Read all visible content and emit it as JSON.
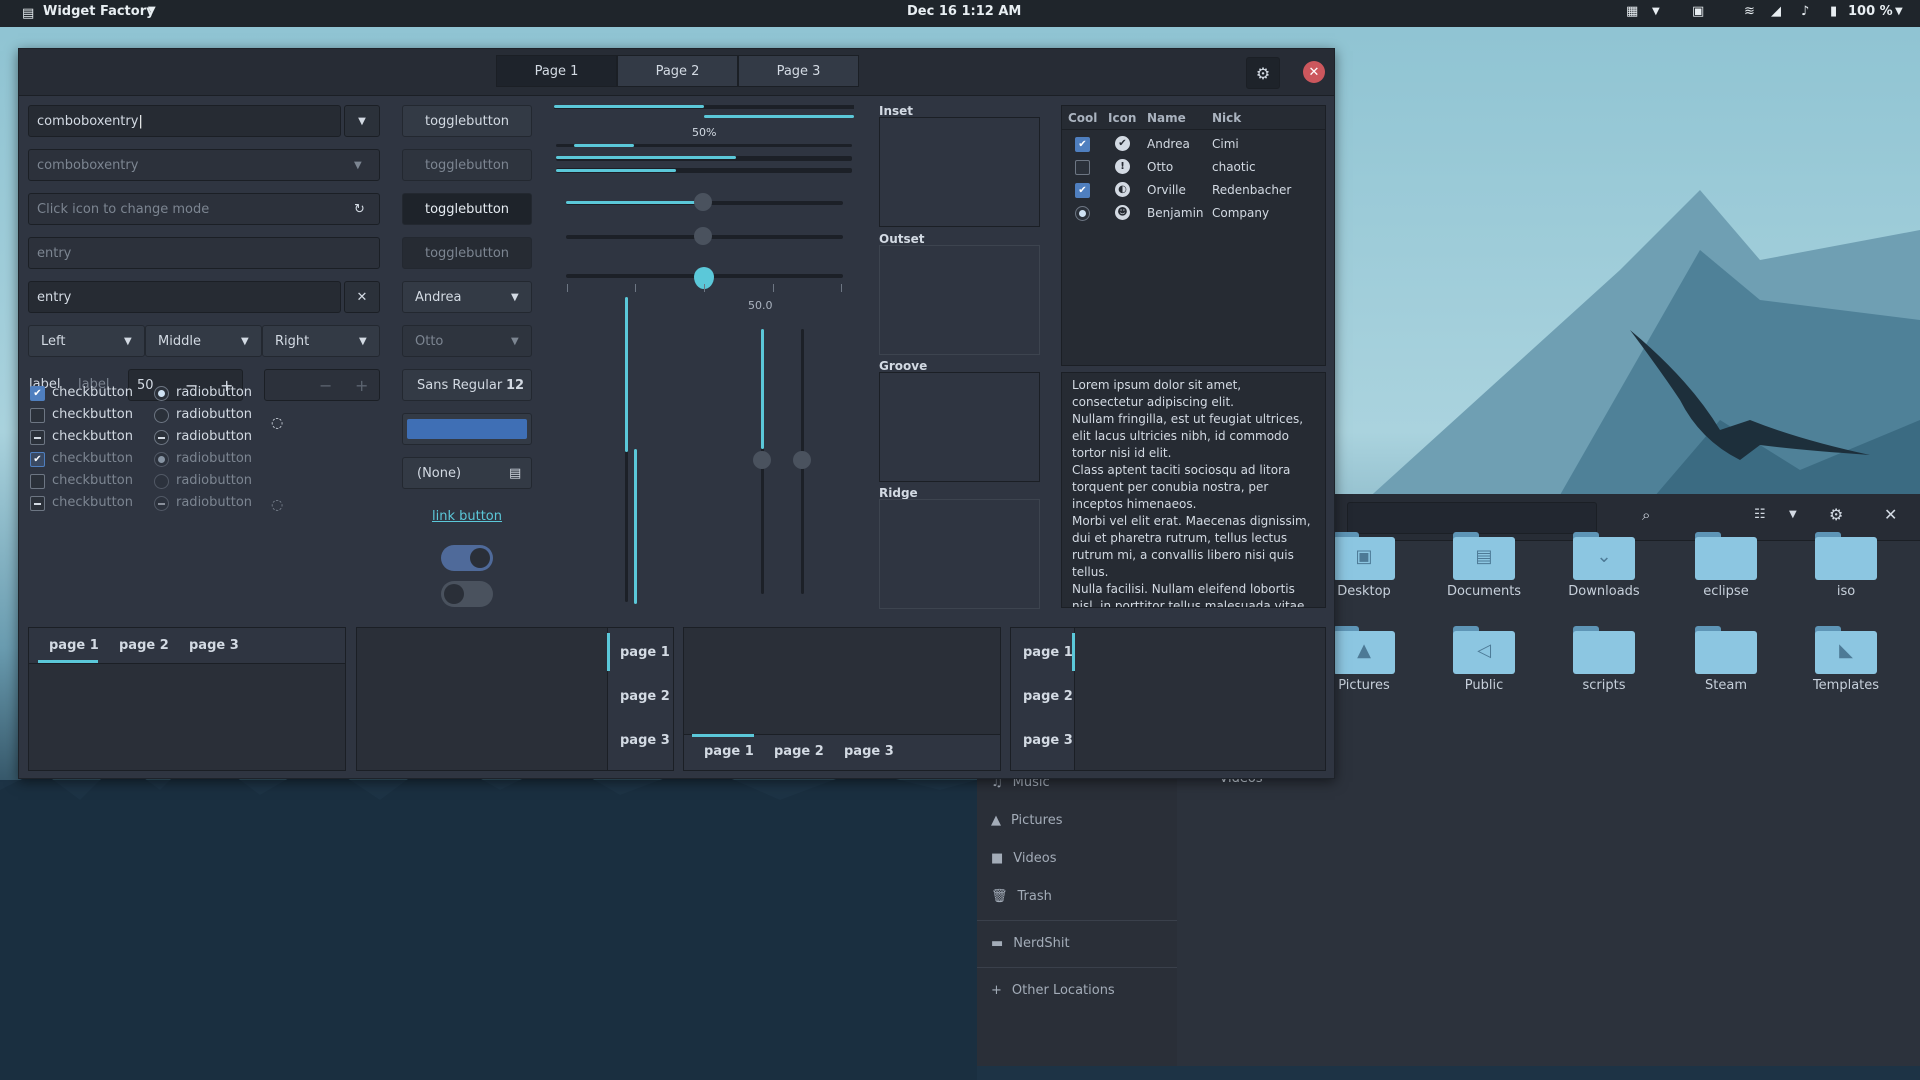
{
  "topbar": {
    "app_name": "Widget Factory",
    "clock": "Dec 16  1:12 AM",
    "battery": "100 %"
  },
  "wf": {
    "tabs": [
      "Page 1",
      "Page 2",
      "Page 3"
    ],
    "entries": {
      "combo1": "comboboxentry",
      "combo2": "comboboxentry",
      "mode_placeholder": "Click icon to change mode",
      "entry1": "entry",
      "entry2": "entry"
    },
    "align_combo": [
      "Left",
      "Middle",
      "Right"
    ],
    "labels": [
      "label",
      "label"
    ],
    "spin_value": "50",
    "checks": [
      {
        "label": "checkbutton",
        "state": "checked"
      },
      {
        "label": "checkbutton",
        "state": "unchecked"
      },
      {
        "label": "checkbutton",
        "state": "mixed"
      },
      {
        "label": "checkbutton",
        "state": "checked-insensitive"
      },
      {
        "label": "checkbutton",
        "state": "unchecked-insensitive"
      },
      {
        "label": "checkbutton",
        "state": "mixed-insensitive"
      }
    ],
    "radios": [
      {
        "label": "radiobutton",
        "state": "selected"
      },
      {
        "label": "radiobutton",
        "state": "unselected"
      },
      {
        "label": "radiobutton",
        "state": "mixed"
      },
      {
        "label": "radiobutton",
        "state": "selected-insensitive"
      },
      {
        "label": "radiobutton",
        "state": "unselected-insensitive"
      },
      {
        "label": "radiobutton",
        "state": "mixed-insensitive"
      }
    ],
    "toggles": [
      "togglebutton",
      "togglebutton",
      "togglebutton",
      "togglebutton"
    ],
    "combos": [
      "Andrea",
      "Otto"
    ],
    "font_button": {
      "name": "Sans Regular",
      "size": "12"
    },
    "file_chooser": "(None)",
    "link_button": "link button",
    "progress_label": "50%",
    "scale_value": "50.0",
    "progress": {
      "top_left": 0.5,
      "top_right": 0.5,
      "bar1": 0.5,
      "bar2": 0.6,
      "bar3": 0.4
    },
    "frames": [
      "Inset",
      "Outset",
      "Groove",
      "Ridge"
    ],
    "tree": {
      "columns": [
        "Cool",
        "Icon",
        "Name",
        "Nick"
      ],
      "rows": [
        {
          "cool": true,
          "icon": "check-circle-icon",
          "name": "Andrea",
          "nick": "Cimi"
        },
        {
          "cool": false,
          "icon": "warning-icon",
          "name": "Otto",
          "nick": "chaotic"
        },
        {
          "cool": true,
          "icon": "half-circle-icon",
          "name": "Orville",
          "nick": "Redenbacher"
        },
        {
          "cool": "radio",
          "icon": "person-icon",
          "name": "Benjamin",
          "nick": "Company"
        }
      ]
    },
    "lorem": "Lorem ipsum dolor sit amet,\nconsectetur adipiscing elit.\nNullam fringilla, est ut feugiat ultrices,\nelit lacus ultricies nibh, id commodo\ntortor nisi id elit.\nClass aptent taciti sociosqu ad litora\ntorquent per conubia nostra, per\ninceptos himenaeos.\nMorbi vel elit erat. Maecenas dignissim,\ndui et pharetra rutrum, tellus lectus\nrutrum mi, a convallis libero nisi quis\ntellus.\nNulla facilisi. Nullam eleifend lobortis\nnisl, in porttitor tellus malesuada vitae.",
    "notebooks": [
      "page 1",
      "page 2",
      "page 3"
    ]
  },
  "nautilus": {
    "sidebar": [
      {
        "label": "Music",
        "icon": "music-icon"
      },
      {
        "label": "Pictures",
        "icon": "picture-icon"
      },
      {
        "label": "Videos",
        "icon": "video-icon"
      },
      {
        "label": "Trash",
        "icon": "trash-icon"
      },
      {
        "label": "NerdShit",
        "icon": "folder-icon"
      },
      {
        "label": "Other Locations",
        "icon": "plus-icon"
      }
    ],
    "folders": [
      "Desktop",
      "Documents",
      "Downloads",
      "eclipse",
      "iso",
      "Pictures",
      "Public",
      "scripts",
      "Steam",
      "Templates",
      "Videos"
    ]
  },
  "colors": {
    "accent": "#5bc8d9",
    "selection": "#3f6fb5",
    "window_bg": "#2f3541",
    "close": "#cc575d"
  }
}
